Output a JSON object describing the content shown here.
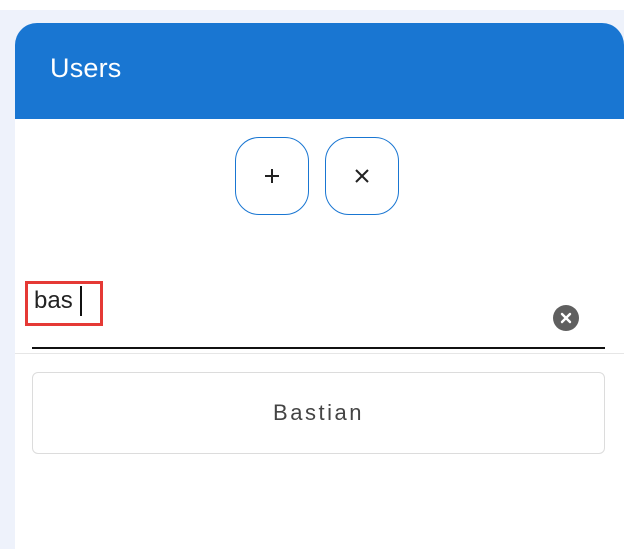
{
  "panel": {
    "title": "Users"
  },
  "toolbar": {
    "add_icon": "plus-icon",
    "clear_icon": "close-icon"
  },
  "search": {
    "value": "bas",
    "clear_icon": "clear-circle-icon"
  },
  "results": {
    "items": [
      {
        "label": "Bastian"
      }
    ]
  },
  "colors": {
    "header": "#1976d2",
    "accent": "#1976d2",
    "highlight": "#e53935"
  }
}
